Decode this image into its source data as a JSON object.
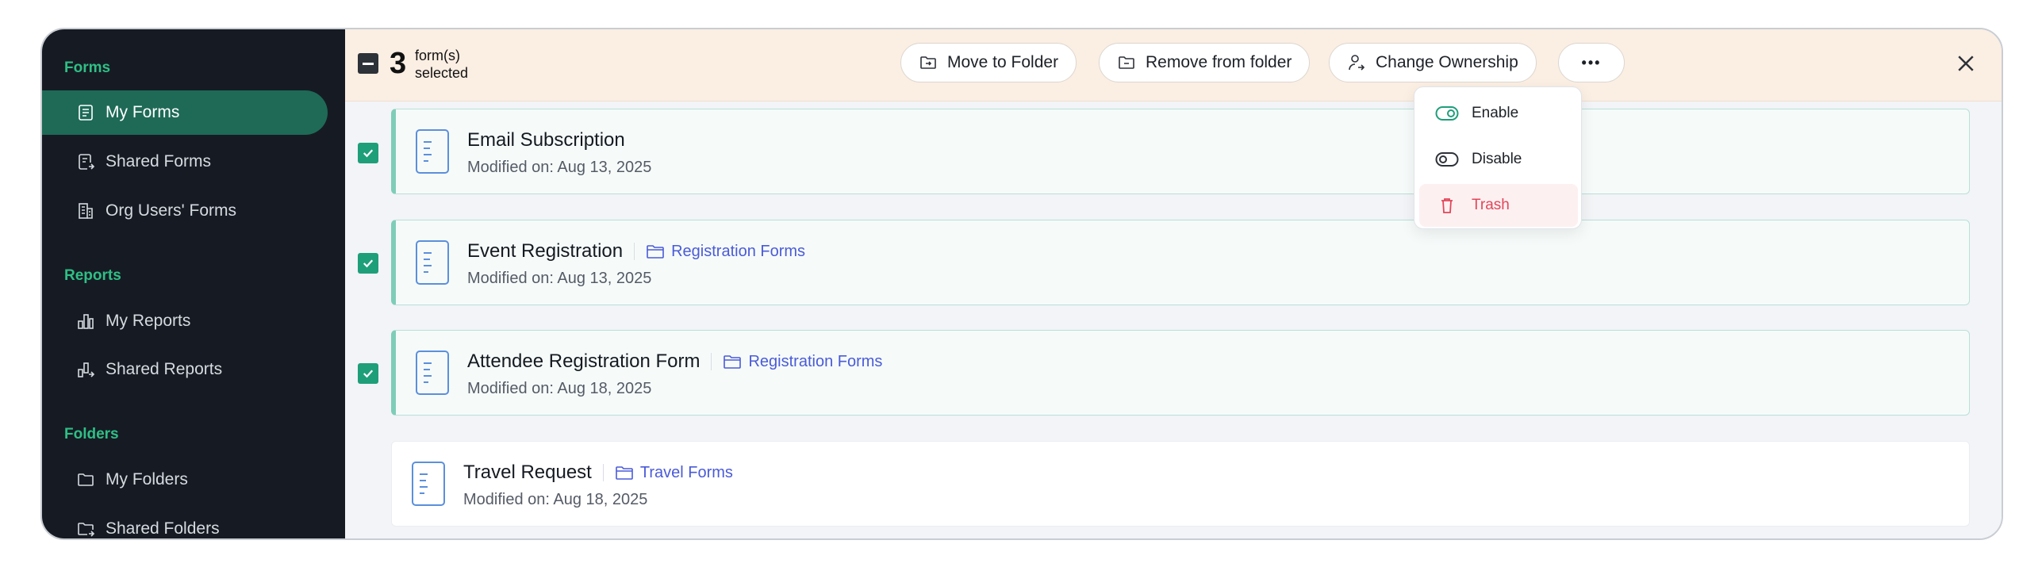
{
  "sidebar": {
    "sections": [
      {
        "label": "Forms",
        "items": [
          {
            "label": "My Forms",
            "icon": "form-icon",
            "active": true
          },
          {
            "label": "Shared Forms",
            "icon": "shared-form-icon"
          },
          {
            "label": "Org Users' Forms",
            "icon": "building-icon"
          }
        ]
      },
      {
        "label": "Reports",
        "items": [
          {
            "label": "My Reports",
            "icon": "bar-chart-icon"
          },
          {
            "label": "Shared Reports",
            "icon": "shared-report-icon"
          }
        ]
      },
      {
        "label": "Folders",
        "items": [
          {
            "label": "My Folders",
            "icon": "folder-icon"
          },
          {
            "label": "Shared Folders",
            "icon": "shared-folder-icon"
          }
        ]
      }
    ]
  },
  "toolbar": {
    "selected_count": "3",
    "selected_label_line1": "form(s)",
    "selected_label_line2": "selected",
    "move_to_folder": "Move to Folder",
    "remove_from_folder": "Remove from folder",
    "change_ownership": "Change Ownership",
    "more": "•••"
  },
  "dropdown": {
    "enable": "Enable",
    "disable": "Disable",
    "trash": "Trash"
  },
  "forms": [
    {
      "title": "Email Subscription",
      "folder": "",
      "modified": "Modified on: Aug 13, 2025",
      "selected": true
    },
    {
      "title": "Event Registration",
      "folder": "Registration Forms",
      "modified": "Modified on: Aug 13, 2025",
      "selected": true
    },
    {
      "title": "Attendee Registration Form",
      "folder": "Registration Forms",
      "modified": "Modified on: Aug 18, 2025",
      "selected": true
    },
    {
      "title": "Travel Request",
      "folder": "Travel Forms",
      "modified": "Modified on: Aug 18, 2025",
      "selected": false
    }
  ],
  "colors": {
    "accent": "#2fbf86",
    "sidebar_bg": "#161b23",
    "active_item": "#1e6a57",
    "topbar_bg": "#fbeee3",
    "folder_link": "#4a5bd8",
    "danger": "#e0465a"
  }
}
